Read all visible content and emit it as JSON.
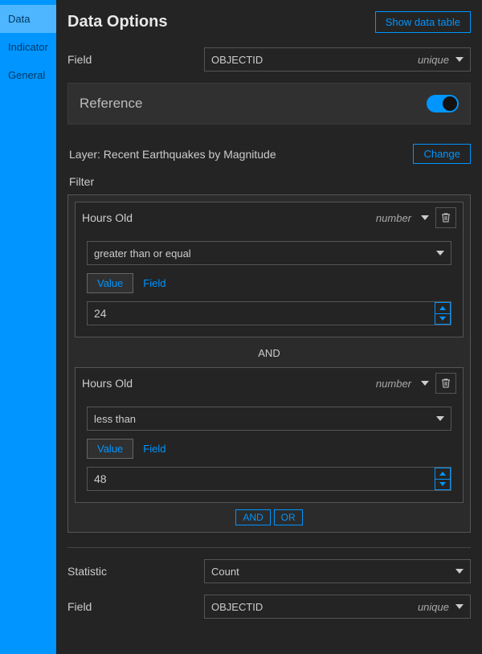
{
  "sidebar": {
    "items": [
      {
        "label": "Data",
        "active": true
      },
      {
        "label": "Indicator",
        "active": false
      },
      {
        "label": "General",
        "active": false
      }
    ]
  },
  "header": {
    "title": "Data Options",
    "show_table_btn": "Show data table"
  },
  "field_row": {
    "label": "Field",
    "value": "OBJECTID",
    "type_hint": "unique"
  },
  "reference": {
    "title": "Reference",
    "toggle_on": true,
    "layer_label": "Layer: Recent Earthquakes by Magnitude",
    "change_btn": "Change"
  },
  "filter": {
    "label": "Filter",
    "and_label": "AND",
    "or_label": "OR",
    "expressions": [
      {
        "field": "Hours Old",
        "type_hint": "number",
        "operator": "greater than or equal",
        "tab_value": "Value",
        "tab_field": "Field",
        "value": "24"
      },
      {
        "field": "Hours Old",
        "type_hint": "number",
        "operator": "less than",
        "tab_value": "Value",
        "tab_field": "Field",
        "value": "48"
      }
    ]
  },
  "statistic_row": {
    "label": "Statistic",
    "value": "Count"
  },
  "field_row2": {
    "label": "Field",
    "value": "OBJECTID",
    "type_hint": "unique"
  }
}
